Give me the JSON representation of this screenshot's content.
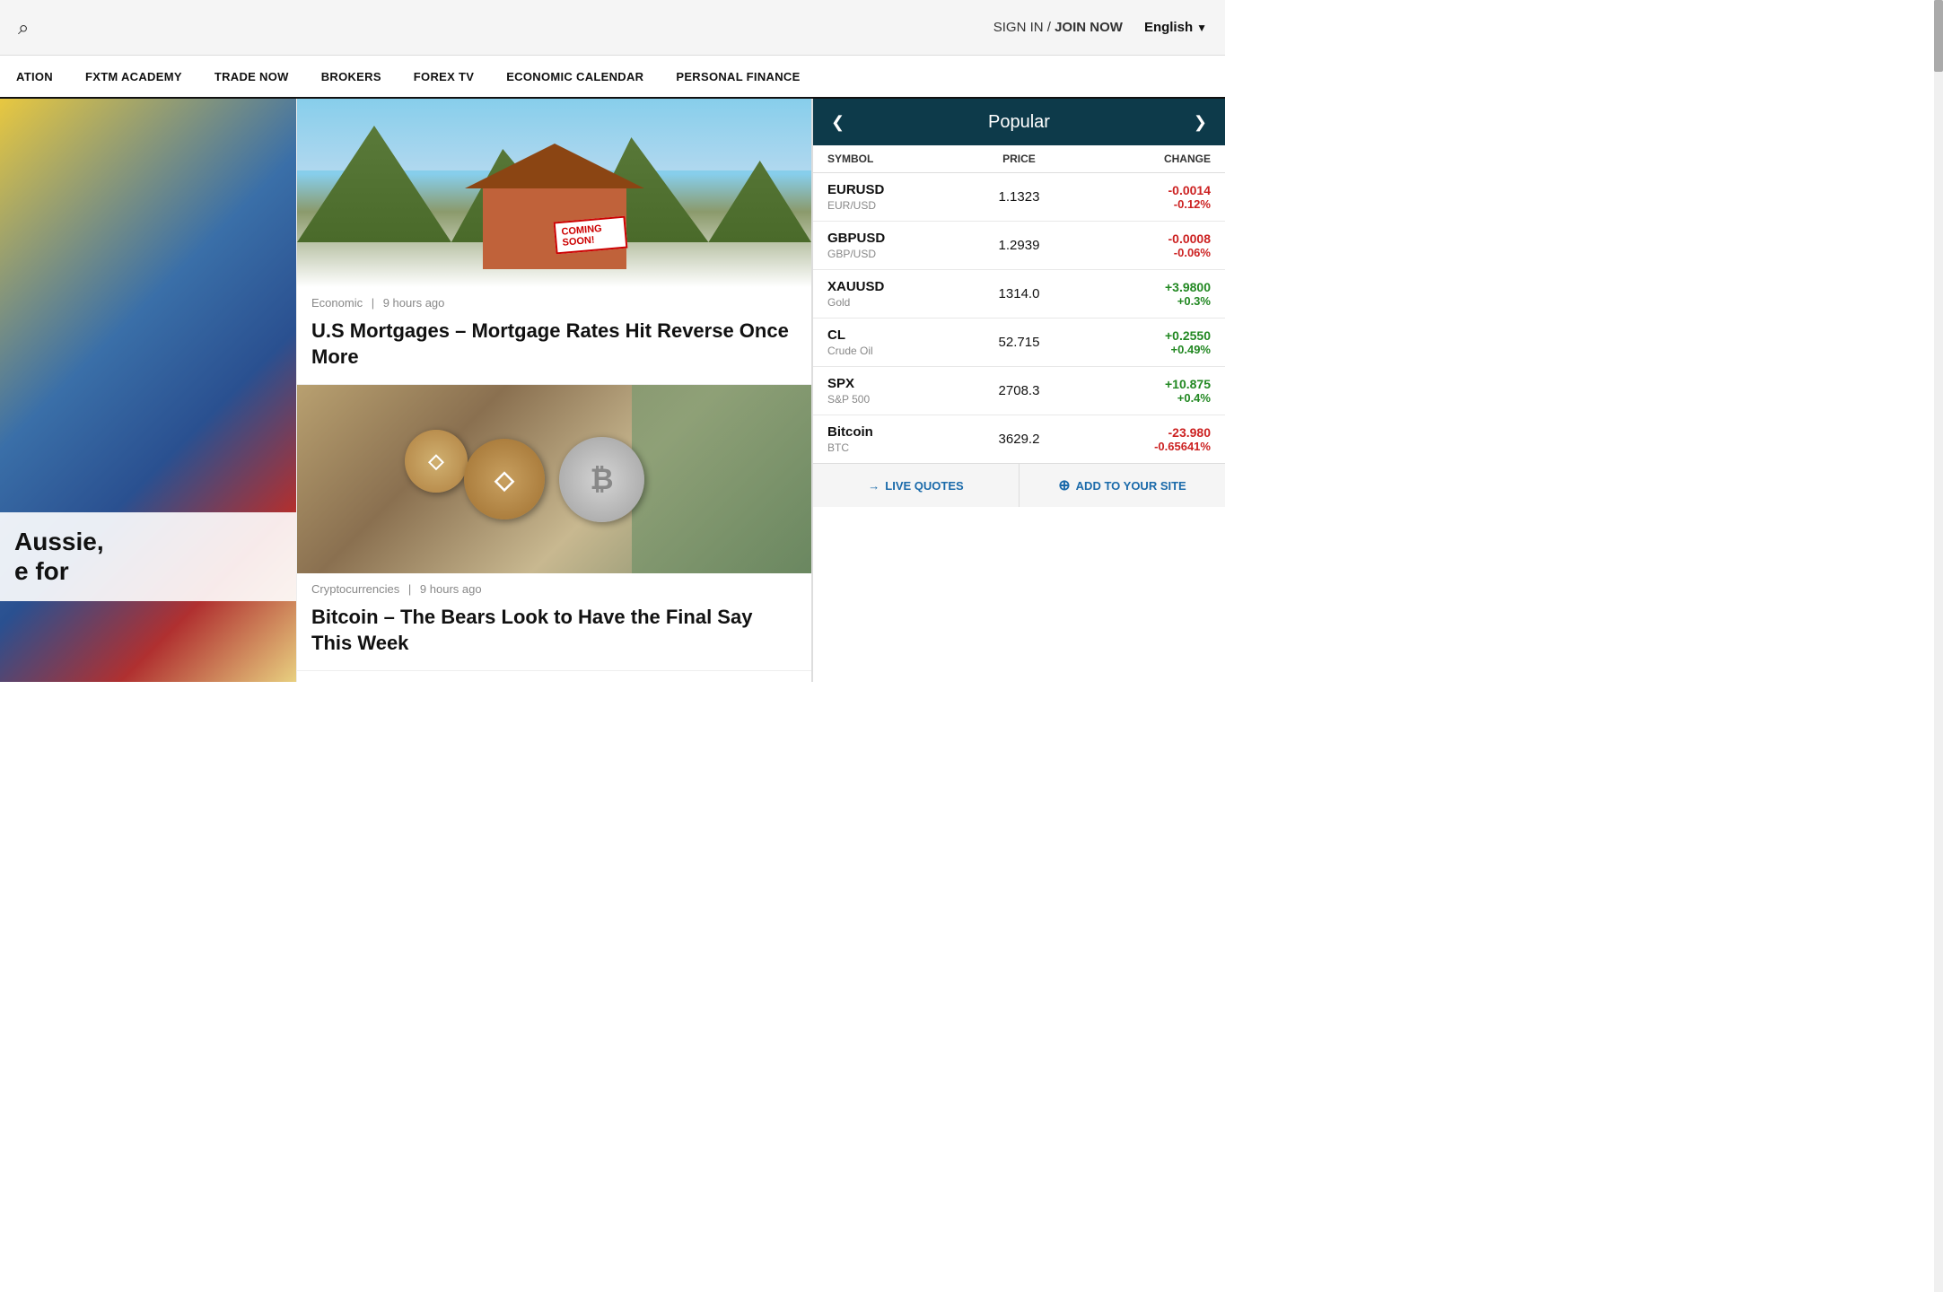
{
  "header": {
    "sign_in_label": "SIGN IN /",
    "join_label": "JOIN NOW",
    "language": "English",
    "language_chevron": "▼"
  },
  "nav": {
    "items": [
      {
        "id": "education",
        "label": "ATION"
      },
      {
        "id": "fxtm-academy",
        "label": "FXTM ACADEMY"
      },
      {
        "id": "trade-now",
        "label": "TRADE NOW"
      },
      {
        "id": "brokers",
        "label": "BROKERS"
      },
      {
        "id": "forex-tv",
        "label": "FOREX TV"
      },
      {
        "id": "economic-calendar",
        "label": "ECONOMIC CALENDAR"
      },
      {
        "id": "personal-finance",
        "label": "PERSONAL FINANCE"
      }
    ]
  },
  "hero": {
    "text_line1": "Aussie,",
    "text_line2": "e for"
  },
  "articles": [
    {
      "id": "mortgage",
      "category": "Economic",
      "time_ago": "9 hours ago",
      "title": "U.S Mortgages – Mortgage Rates Hit Reverse Once More"
    },
    {
      "id": "bitcoin",
      "category": "Cryptocurrencies",
      "time_ago": "9 hours ago",
      "title": "Bitcoin – The Bears Look to Have the Final Say This Week"
    }
  ],
  "market": {
    "header_title": "Popular",
    "col_symbol": "SYMBOL",
    "col_price": "PRICE",
    "col_change": "CHANGE",
    "rows": [
      {
        "symbol": "EURUSD",
        "sub": "EUR/USD",
        "price": "1.1323",
        "change_val": "-0.0014",
        "change_pct": "-0.12%",
        "positive": false
      },
      {
        "symbol": "GBPUSD",
        "sub": "GBP/USD",
        "price": "1.2939",
        "change_val": "-0.0008",
        "change_pct": "-0.06%",
        "positive": false
      },
      {
        "symbol": "XAUUSD",
        "sub": "Gold",
        "price": "1314.0",
        "change_val": "+3.9800",
        "change_pct": "+0.3%",
        "positive": true
      },
      {
        "symbol": "CL",
        "sub": "Crude Oil",
        "price": "52.715",
        "change_val": "+0.2550",
        "change_pct": "+0.49%",
        "positive": true
      },
      {
        "symbol": "SPX",
        "sub": "S&P 500",
        "price": "2708.3",
        "change_val": "+10.875",
        "change_pct": "+0.4%",
        "positive": true
      },
      {
        "symbol": "Bitcoin",
        "sub": "BTC",
        "price": "3629.2",
        "change_val": "-23.980",
        "change_pct": "-0.65641%",
        "positive": false
      }
    ],
    "footer_live_quotes": "LIVE QUOTES",
    "footer_add_to_site": "ADD TO YOUR SITE",
    "footer_live_arrow": "→",
    "footer_add_plus": "⊕"
  }
}
